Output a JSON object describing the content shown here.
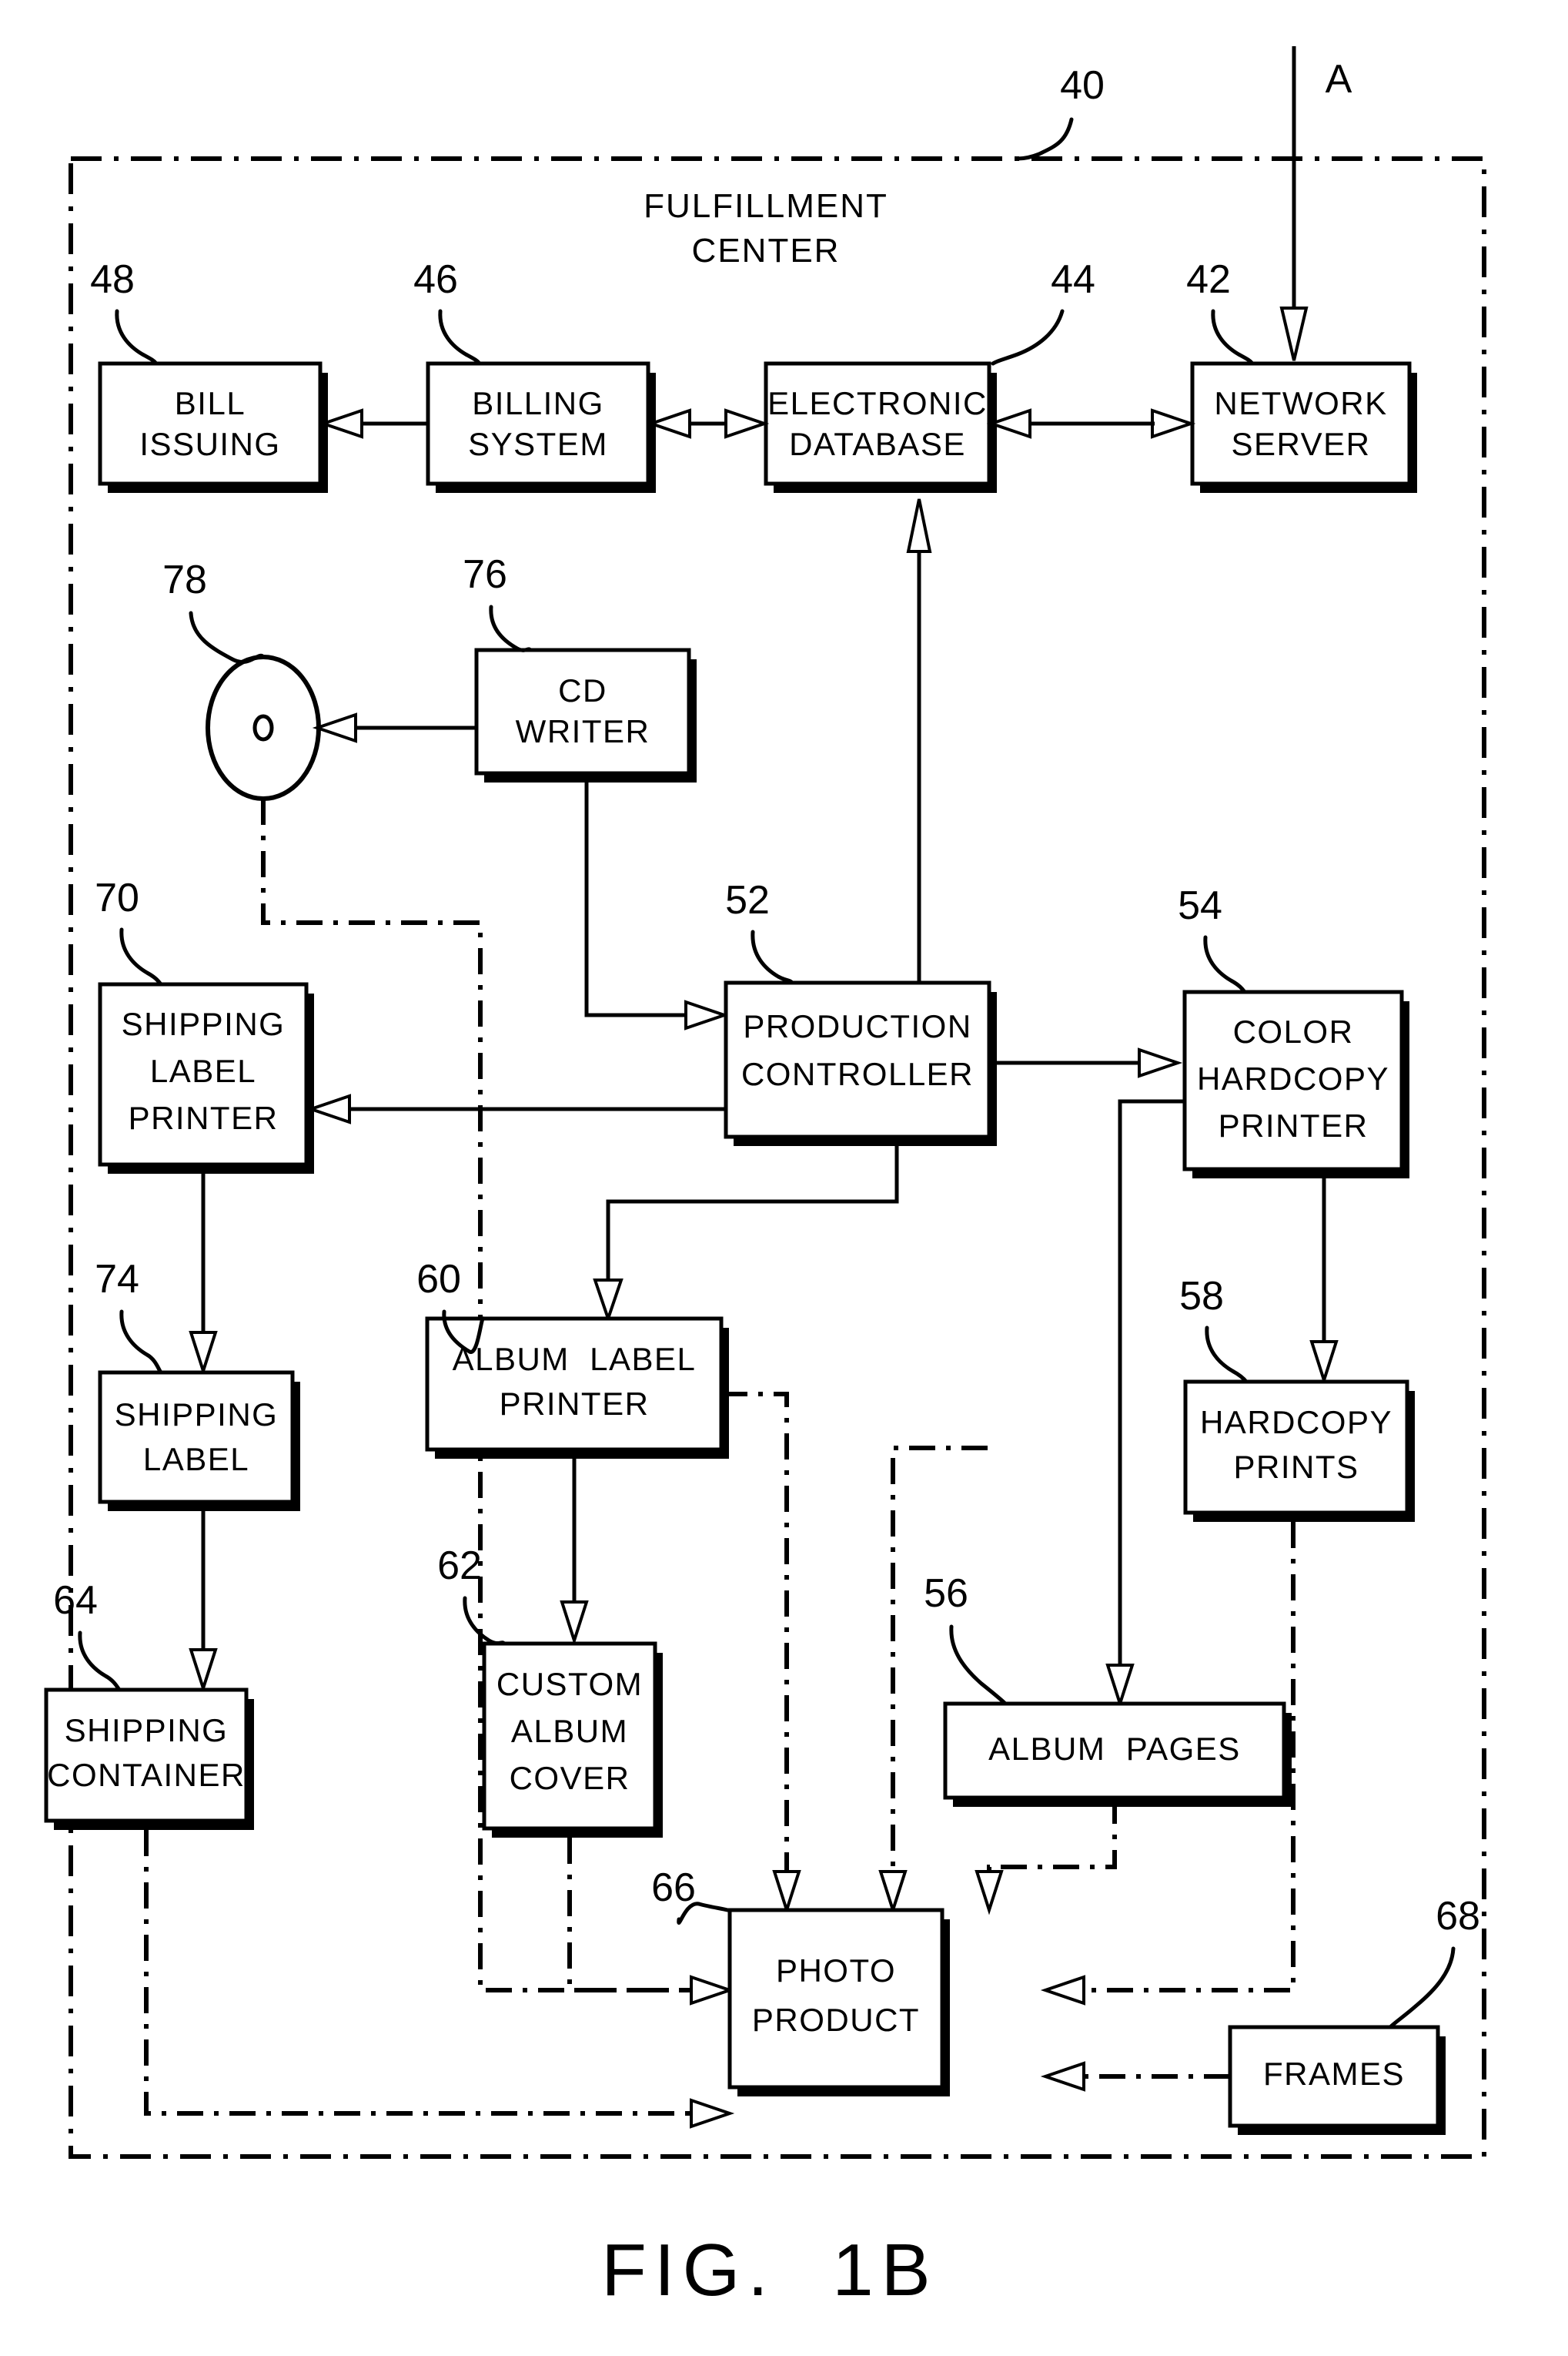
{
  "figure": {
    "caption": "FIG.  1B",
    "enclosure_label": "FULFILLMENT\nCENTER",
    "enclosure_ref": "40",
    "offpage_connector": "A",
    "stroke_color": "#000000",
    "background_color": "#ffffff"
  },
  "nodes": [
    {
      "id": "bill_issuing",
      "ref": "48",
      "label": "BILL\nISSUING"
    },
    {
      "id": "billing_system",
      "ref": "46",
      "label": "BILLING\nSYSTEM"
    },
    {
      "id": "electronic_database",
      "ref": "44",
      "label": "ELECTRONIC\nDATABASE"
    },
    {
      "id": "network_server",
      "ref": "42",
      "label": "NETWORK\nSERVER"
    },
    {
      "id": "cd_disc",
      "ref": "78",
      "label": ""
    },
    {
      "id": "cd_writer",
      "ref": "76",
      "label": "CD\nWRITER"
    },
    {
      "id": "shipping_label_printer",
      "ref": "70",
      "label": "SHIPPING\nLABEL\nPRINTER"
    },
    {
      "id": "production_controller",
      "ref": "52",
      "label": "PRODUCTION\nCONTROLLER"
    },
    {
      "id": "color_hardcopy_printer",
      "ref": "54",
      "label": "COLOR\nHARDCOPY\nPRINTER"
    },
    {
      "id": "shipping_label",
      "ref": "74",
      "label": "SHIPPING\nLABEL"
    },
    {
      "id": "album_label_printer",
      "ref": "60",
      "label": "ALBUM  LABEL\nPRINTER"
    },
    {
      "id": "hardcopy_prints",
      "ref": "58",
      "label": "HARDCOPY\nPRINTS"
    },
    {
      "id": "shipping_container",
      "ref": "64",
      "label": "SHIPPING\nCONTAINER"
    },
    {
      "id": "custom_album_cover",
      "ref": "62",
      "label": "CUSTOM\nALBUM\nCOVER"
    },
    {
      "id": "album_pages",
      "ref": "56",
      "label": "ALBUM  PAGES"
    },
    {
      "id": "photo_product",
      "ref": "66",
      "label": "PHOTO\nPRODUCT"
    },
    {
      "id": "frames",
      "ref": "68",
      "label": "FRAMES"
    }
  ],
  "connections": [
    {
      "from": "billing_system",
      "to": "bill_issuing",
      "style": "solid",
      "direction": "single"
    },
    {
      "from": "electronic_database",
      "to": "billing_system",
      "style": "solid",
      "direction": "double"
    },
    {
      "from": "network_server",
      "to": "electronic_database",
      "style": "solid",
      "direction": "double"
    },
    {
      "from": "offpage_A",
      "to": "network_server",
      "style": "solid",
      "direction": "single"
    },
    {
      "from": "cd_writer",
      "to": "cd_disc",
      "style": "solid",
      "direction": "single"
    },
    {
      "from": "cd_writer",
      "to": "production_controller",
      "style": "solid",
      "direction": "single"
    },
    {
      "from": "production_controller",
      "to": "electronic_database",
      "style": "solid",
      "direction": "single"
    },
    {
      "from": "production_controller",
      "to": "color_hardcopy_printer",
      "style": "solid",
      "direction": "single"
    },
    {
      "from": "production_controller",
      "to": "shipping_label_printer",
      "style": "solid",
      "direction": "single"
    },
    {
      "from": "production_controller",
      "to": "album_label_printer",
      "style": "solid",
      "direction": "single"
    },
    {
      "from": "color_hardcopy_printer",
      "to": "hardcopy_prints",
      "style": "solid",
      "direction": "single"
    },
    {
      "from": "color_hardcopy_printer",
      "to": "album_pages",
      "style": "solid",
      "direction": "single"
    },
    {
      "from": "shipping_label_printer",
      "to": "shipping_label",
      "style": "solid",
      "direction": "single"
    },
    {
      "from": "shipping_label",
      "to": "shipping_container",
      "style": "solid",
      "direction": "single"
    },
    {
      "from": "album_label_printer",
      "to": "custom_album_cover",
      "style": "solid",
      "direction": "single"
    },
    {
      "from": "cd_disc",
      "to": "photo_product",
      "style": "dash-dot",
      "direction": "single"
    },
    {
      "from": "shipping_container",
      "to": "photo_product",
      "style": "dash-dot",
      "direction": "single"
    },
    {
      "from": "custom_album_cover",
      "to": "photo_product",
      "style": "dash-dot",
      "direction": "single"
    },
    {
      "from": "album_label_printer",
      "to": "photo_product",
      "style": "dash-dot",
      "direction": "single"
    },
    {
      "from": "album_pages",
      "to": "photo_product",
      "style": "dash-dot",
      "direction": "single"
    },
    {
      "from": "hardcopy_prints",
      "to": "photo_product",
      "style": "dash-dot",
      "direction": "single"
    },
    {
      "from": "frames",
      "to": "photo_product",
      "style": "dash-dot",
      "direction": "single"
    }
  ]
}
